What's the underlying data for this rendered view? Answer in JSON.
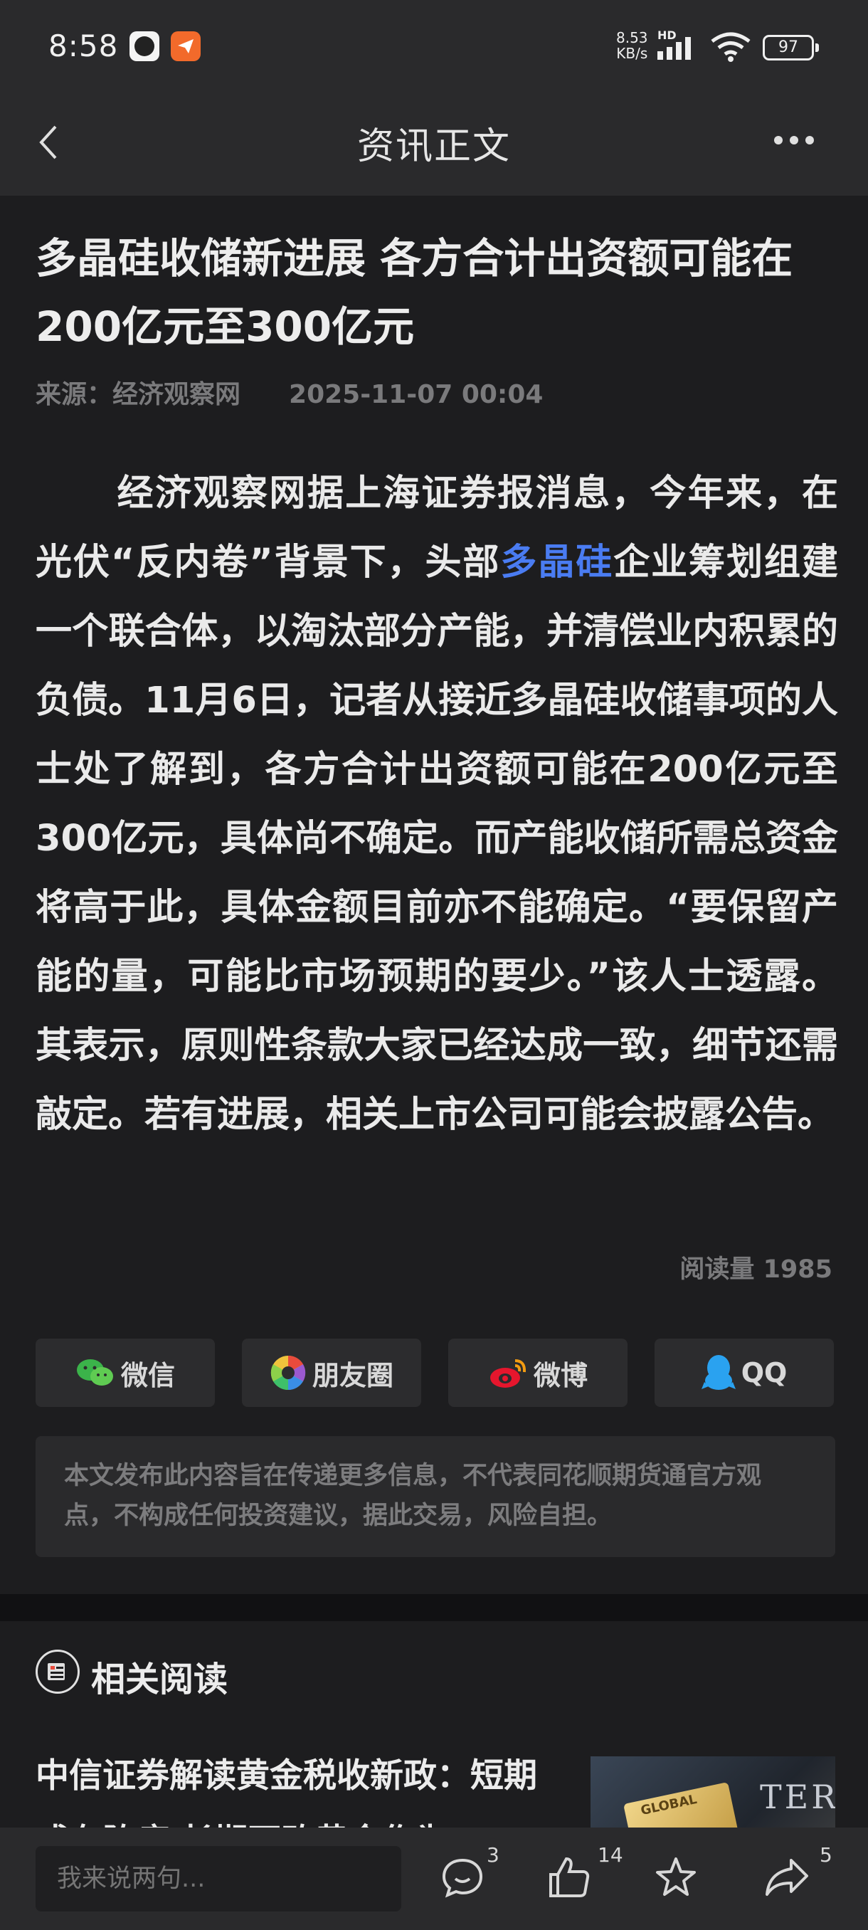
{
  "status_bar": {
    "time": "8:58",
    "net_speed_value": "8.53",
    "net_speed_unit": "KB/s",
    "hd_label": "HD",
    "battery": "97"
  },
  "nav": {
    "title": "资讯正文"
  },
  "article": {
    "title": "多晶硅收储新进展 各方合计出资额可能在200亿元至300亿元",
    "source": "来源：经济观察网",
    "date": "2025-11-07 00:04",
    "body_before_link": "经济观察网据上海证券报消息，今年来，在光伏“反内卷”背景下，头部",
    "body_link": "多晶硅",
    "body_after_link": "企业筹划组建一个联合体，以淘汰部分产能，并清偿业内积累的负债。11月6日，记者从接近多晶硅收储事项的人士处了解到，各方合计出资额可能在200亿元至300亿元，具体尚不确定。而产能收储所需总资金将高于此，具体金额目前亦不能确定。“要保留产能的量，可能比市场预期的要少。”该人士透露。其表示，原则性条款大家已经达成一致，细节还需敲定。若有进展，相关上市公司可能会披露公告。",
    "read_count": "阅读量 1985"
  },
  "share": {
    "wechat": "微信",
    "moments": "朋友圈",
    "weibo": "微博",
    "qq": "QQ"
  },
  "disclaimer": "本文发布此内容旨在传递更多信息，不代表同花顺期货通官方观点，不构成任何投资建议，据此交易，风险自担。",
  "related": {
    "section_title": "相关阅读",
    "item_title": "中信证券解读黄金税收新政：短期或有阵痛 长期不改黄金作为",
    "thumb_badge": "GLOBAL",
    "thumb_word": "TER"
  },
  "bottom_bar": {
    "comment_placeholder": "我来说两句...",
    "comment_count": "3",
    "like_count": "14",
    "share_count": "5"
  },
  "colors": {
    "background": "#1d1d1f",
    "bar": "#2a2a2c",
    "link": "#4a7cf2"
  }
}
